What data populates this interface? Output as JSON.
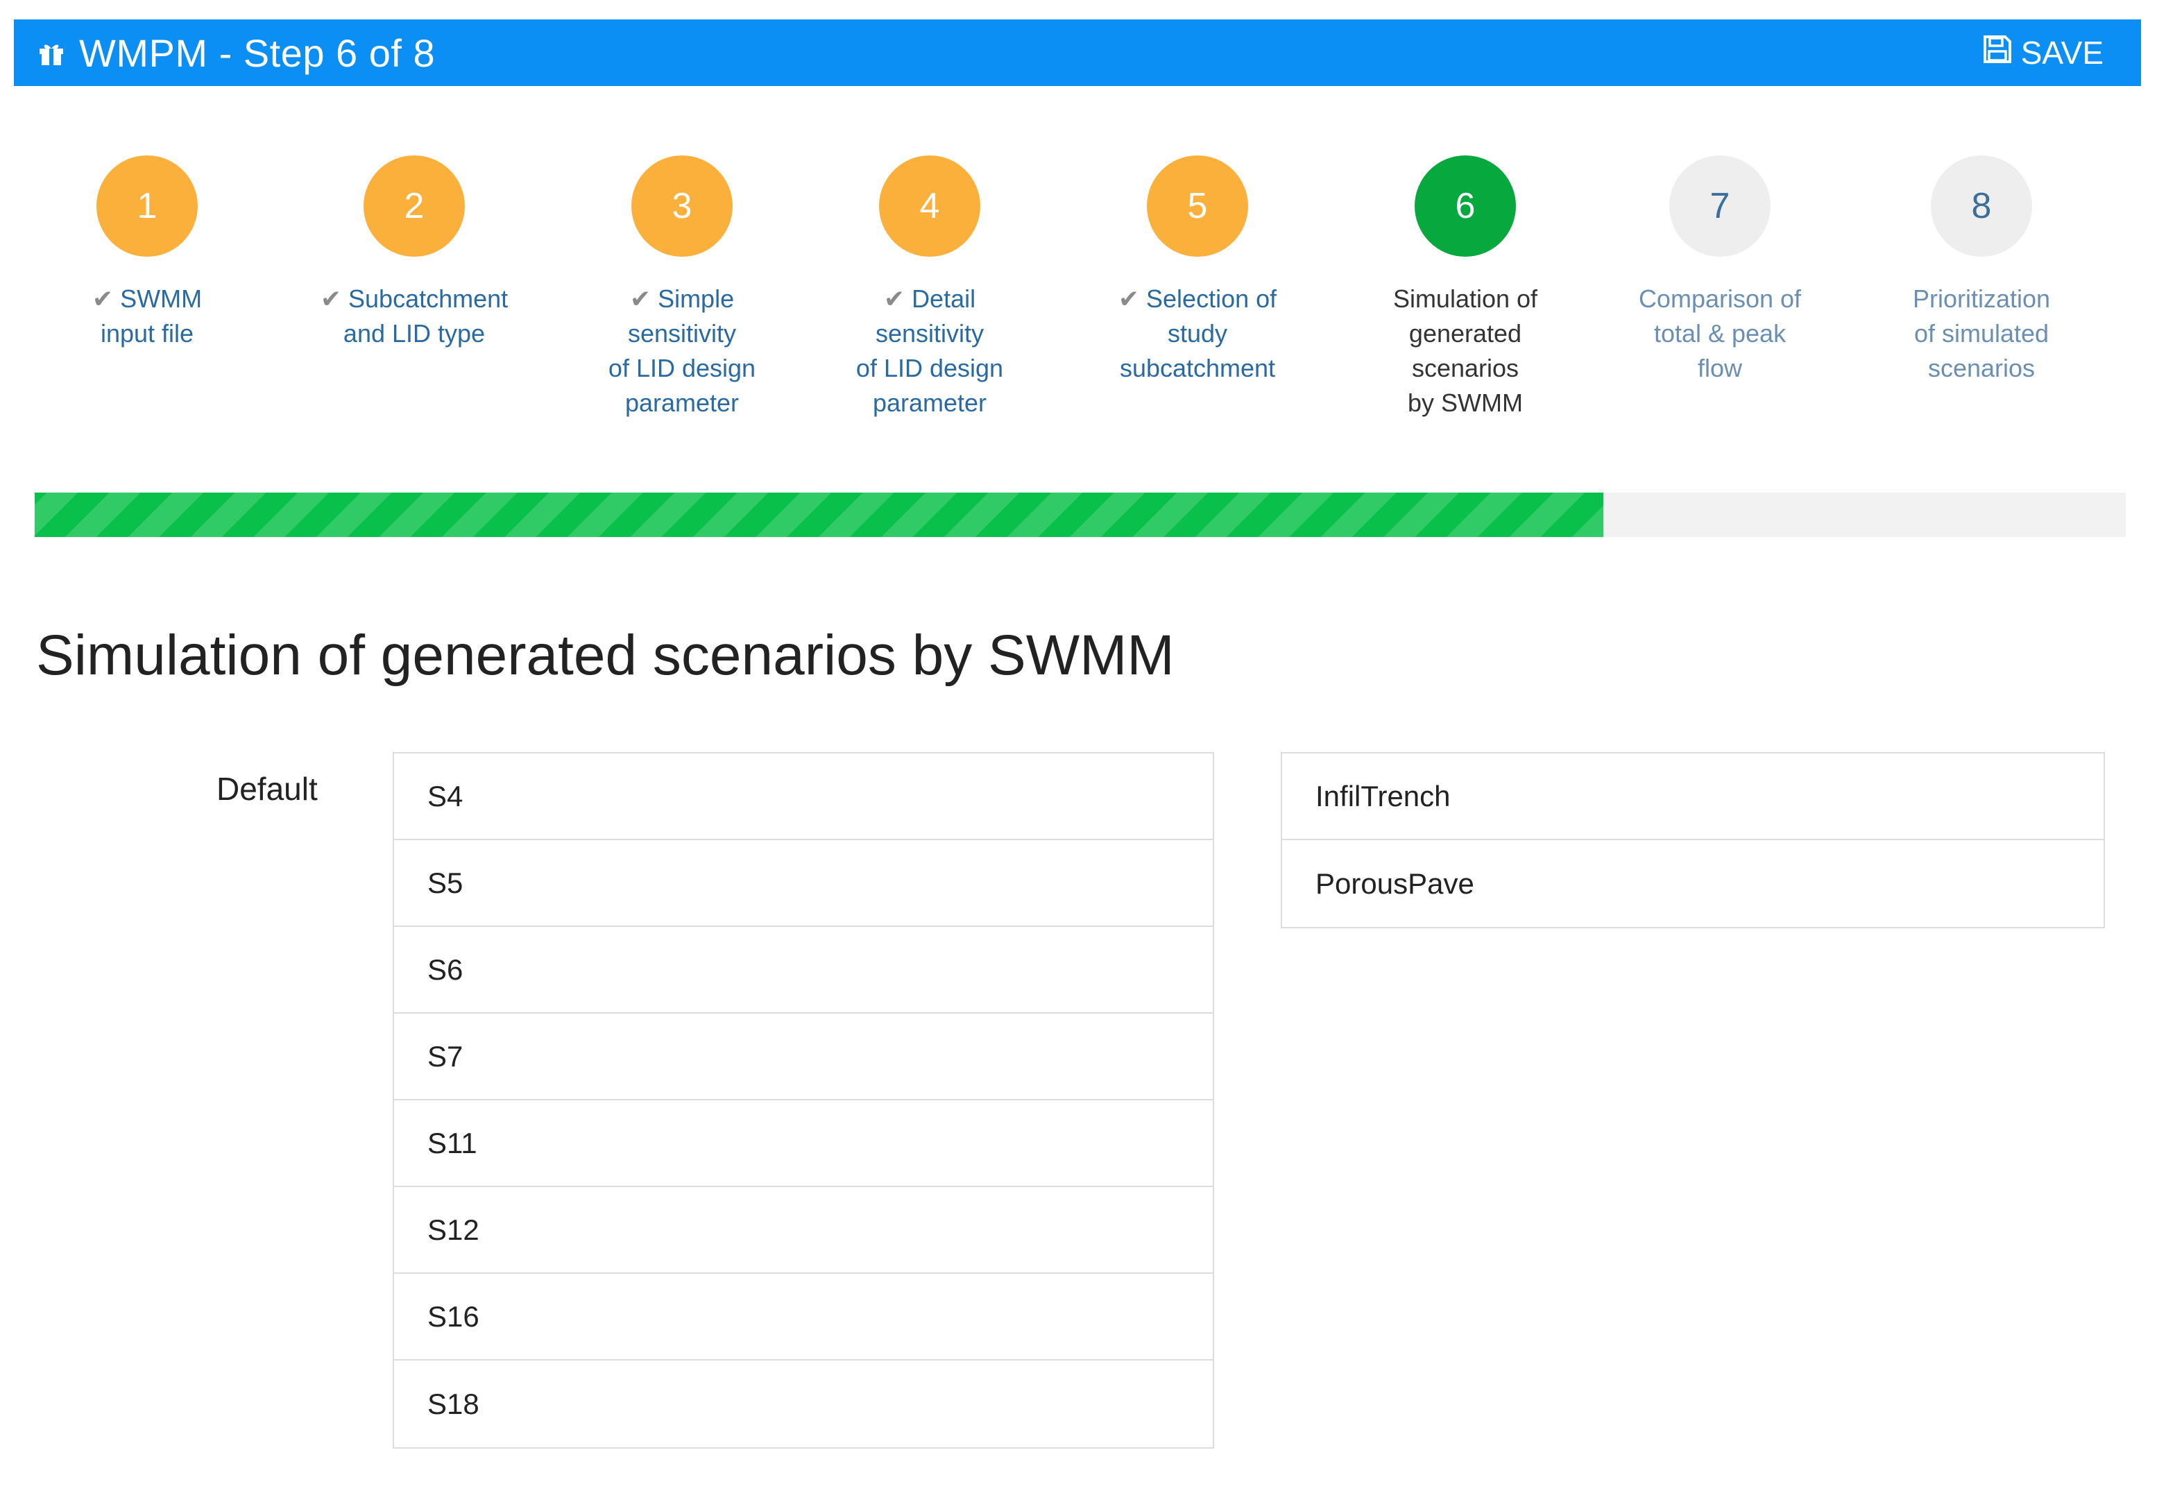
{
  "header": {
    "title": "WMPM - Step 6 of 8",
    "save_label": "SAVE",
    "brand_icon": "gift-icon",
    "save_icon": "floppy-disk-icon",
    "color": "#0b8ff5"
  },
  "progress": {
    "current_step": 6,
    "total_steps": 8,
    "fraction": 0.75,
    "fill_color": "#08c04a"
  },
  "steps": [
    {
      "number": "1",
      "lines": [
        "SWMM",
        "input file"
      ],
      "status": "completed"
    },
    {
      "number": "2",
      "lines": [
        "Subcatchment",
        "and LID type"
      ],
      "status": "completed"
    },
    {
      "number": "3",
      "lines": [
        "Simple",
        "sensitivity",
        "of LID design",
        "parameter"
      ],
      "status": "completed"
    },
    {
      "number": "4",
      "lines": [
        "Detail",
        "sensitivity",
        "of LID design",
        "parameter"
      ],
      "status": "completed"
    },
    {
      "number": "5",
      "lines": [
        "Selection of",
        "study",
        "subcatchment"
      ],
      "status": "completed"
    },
    {
      "number": "6",
      "lines": [
        "Simulation of",
        "generated",
        "scenarios",
        "by SWMM"
      ],
      "status": "active"
    },
    {
      "number": "7",
      "lines": [
        "Comparison of",
        "total & peak",
        "flow"
      ],
      "status": "todo"
    },
    {
      "number": "8",
      "lines": [
        "Prioritization",
        "of simulated",
        "scenarios"
      ],
      "status": "todo"
    }
  ],
  "main": {
    "title": "Simulation of generated scenarios by SWMM",
    "group_label": "Default",
    "subcatchments": [
      "S4",
      "S5",
      "S6",
      "S7",
      "S11",
      "S12",
      "S16",
      "S18"
    ],
    "lid_types": [
      "InfilTrench",
      "PorousPave"
    ]
  }
}
